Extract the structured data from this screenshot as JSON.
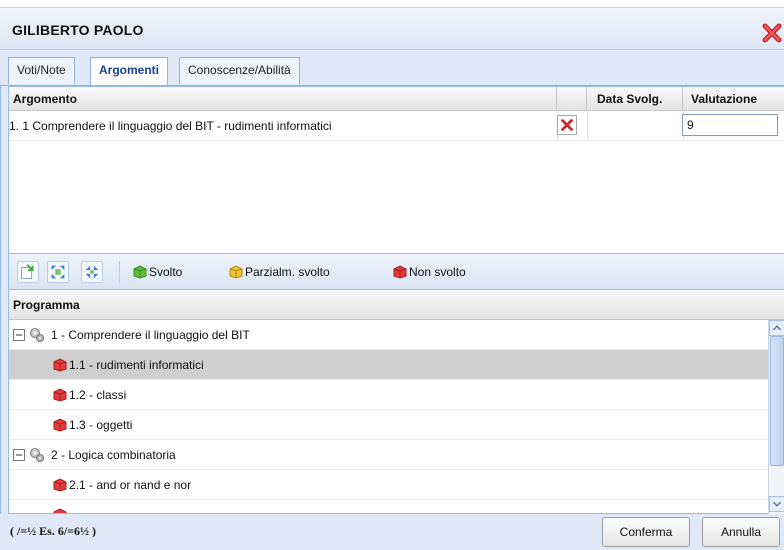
{
  "window": {
    "title": "GILIBERTO PAOLO"
  },
  "tabs": [
    {
      "label": "Voti/Note",
      "active": false
    },
    {
      "label": "Argomenti",
      "active": true
    },
    {
      "label": "Conoscenze/Abilità",
      "active": false
    }
  ],
  "topics_grid": {
    "headers": {
      "argomento": "Argomento",
      "data": "Data Svolg.",
      "valutazione": "Valutazione"
    },
    "rows": [
      {
        "argomento": "1. 1 Comprendere il linguaggio del BIT - rudimenti informatici",
        "data": "",
        "valutazione": "9"
      }
    ]
  },
  "toolbar": {
    "legend": {
      "done": "Svolto",
      "partial": "Parzialm. svolto",
      "not_done": "Non svolto"
    },
    "colors": {
      "done": "#5fbf3a",
      "partial": "#f2c230",
      "not_done": "#e5393b"
    }
  },
  "program_grid": {
    "header": "Programma",
    "rows": [
      {
        "label": "1 - Comprendere il linguaggio del BIT",
        "level": 0,
        "icon": "gear-icon",
        "expander": "⊟"
      },
      {
        "label": "1.1 - rudimenti informatici",
        "level": 1,
        "icon": "box-red-icon",
        "selected": true
      },
      {
        "label": "1.2 - classi",
        "level": 1,
        "icon": "box-red-icon"
      },
      {
        "label": "1.3 - oggetti",
        "level": 1,
        "icon": "box-red-icon"
      },
      {
        "label": "2 - Logica combinatoria",
        "level": 0,
        "icon": "gear-icon",
        "expander": "⊟"
      },
      {
        "label": "2.1 - and or nand e nor",
        "level": 1,
        "icon": "box-red-icon"
      }
    ]
  },
  "footer": {
    "note": "( /=½ Es. 6/=6½ )",
    "confirm_label": "Conferma",
    "cancel_label": "Annulla"
  }
}
